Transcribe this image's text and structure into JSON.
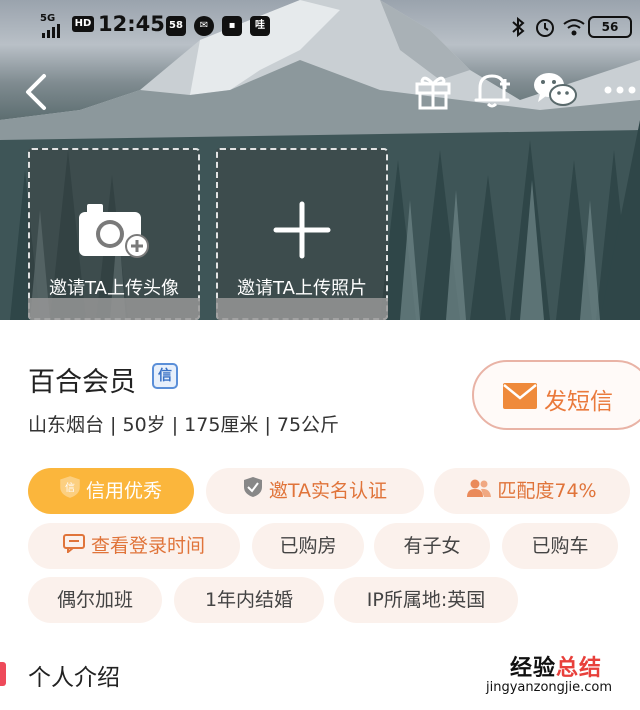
{
  "status_bar": {
    "network": "5G",
    "hd": "HD",
    "time": "12:45",
    "notif_count": "58",
    "app_label": "哇",
    "battery": "56"
  },
  "upload": {
    "avatar_label": "邀请TA上传头像",
    "photo_label": "邀请TA上传照片"
  },
  "profile": {
    "name": "百合会员",
    "verify_badge": "信",
    "info": "山东烟台 | 50岁 | 175厘米 | 75公斤",
    "sms_label": "发短信"
  },
  "tags": {
    "credit": "信用优秀",
    "credit_icon": "信",
    "realname": "邀TA实名认证",
    "match": "匹配度74%",
    "login_time": "查看登录时间",
    "house": "已购房",
    "children": "有子女",
    "car": "已购车",
    "overtime": "偶尔加班",
    "marry": "1年内结婚",
    "ip": "IP所属地:英国"
  },
  "section": {
    "title": "个人介绍"
  },
  "watermark": {
    "cn_part1": "经验",
    "cn_part2": "总结",
    "en": "jingyanzongjie.com"
  },
  "colors": {
    "accent_orange": "#e0743a",
    "gold": "#fbb63c",
    "section_red": "#ee4a5a"
  }
}
